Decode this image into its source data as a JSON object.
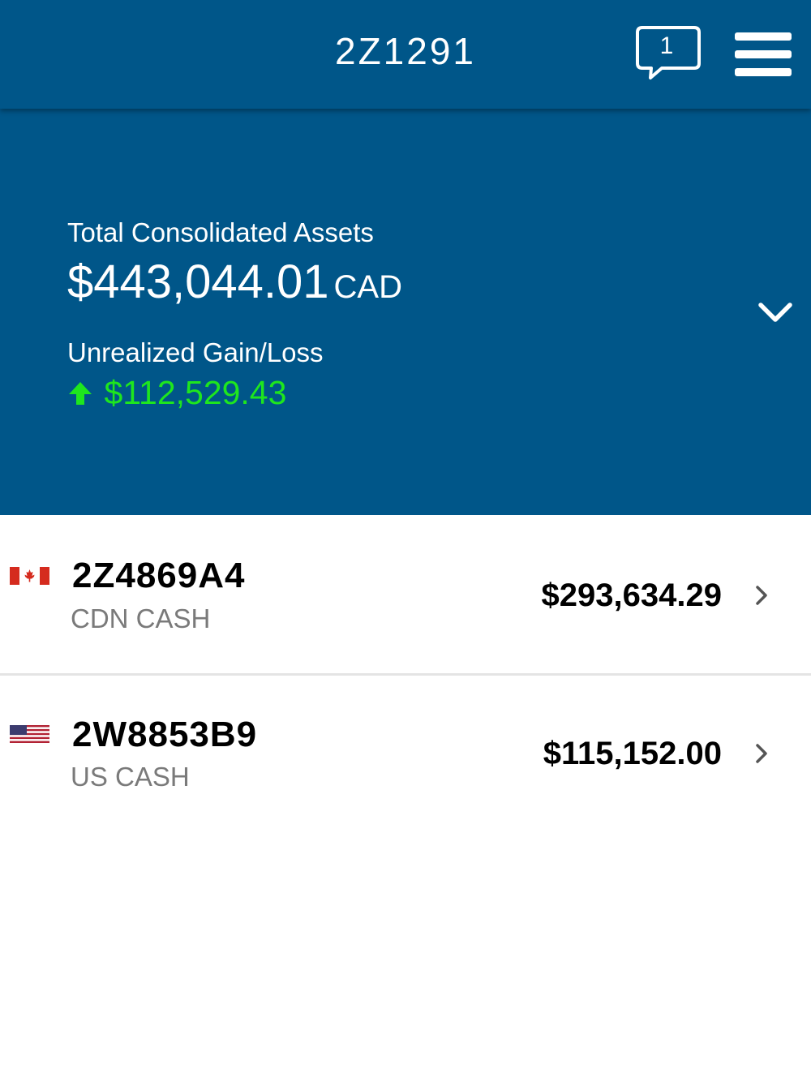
{
  "header": {
    "title": "2Z1291",
    "message_count": "1"
  },
  "summary": {
    "total_label": "Total Consolidated Assets",
    "total_value": "$443,044.01",
    "total_currency": "CAD",
    "gain_label": "Unrealized Gain/Loss",
    "gain_value": "$112,529.43",
    "gain_direction": "up",
    "gain_color": "#1ee61e"
  },
  "accounts": [
    {
      "flag": "canada-flag-icon",
      "number": "2Z4869A4",
      "type": "CDN CASH",
      "balance": "$293,634.29"
    },
    {
      "flag": "us-flag-icon",
      "number": "2W8853B9",
      "type": "US CASH",
      "balance": "$115,152.00"
    }
  ],
  "colors": {
    "header_bg": "#005689",
    "gain_positive": "#1ee61e",
    "text_secondary": "#7a7a7a"
  }
}
